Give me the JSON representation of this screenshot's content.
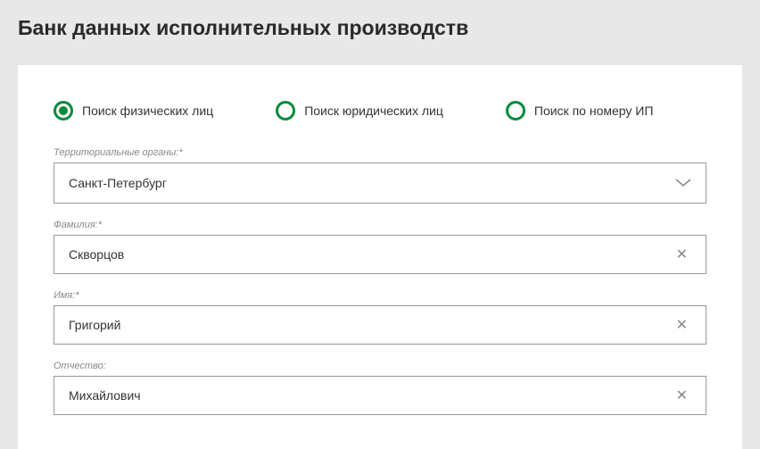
{
  "header": {
    "title": "Банк данных исполнительных производств"
  },
  "radio": {
    "items": [
      {
        "label": "Поиск физических лиц",
        "selected": true
      },
      {
        "label": "Поиск юридических лиц",
        "selected": false
      },
      {
        "label": "Поиск по номеру ИП",
        "selected": false
      }
    ]
  },
  "fields": {
    "territory": {
      "label": "Территориальные органы:*",
      "value": "Санкт-Петербург"
    },
    "surname": {
      "label": "Фамилия:*",
      "value": "Скворцов"
    },
    "name": {
      "label": "Имя:*",
      "value": "Григорий"
    },
    "patronymic": {
      "label": "Отчество:",
      "value": "Михайлович"
    }
  }
}
